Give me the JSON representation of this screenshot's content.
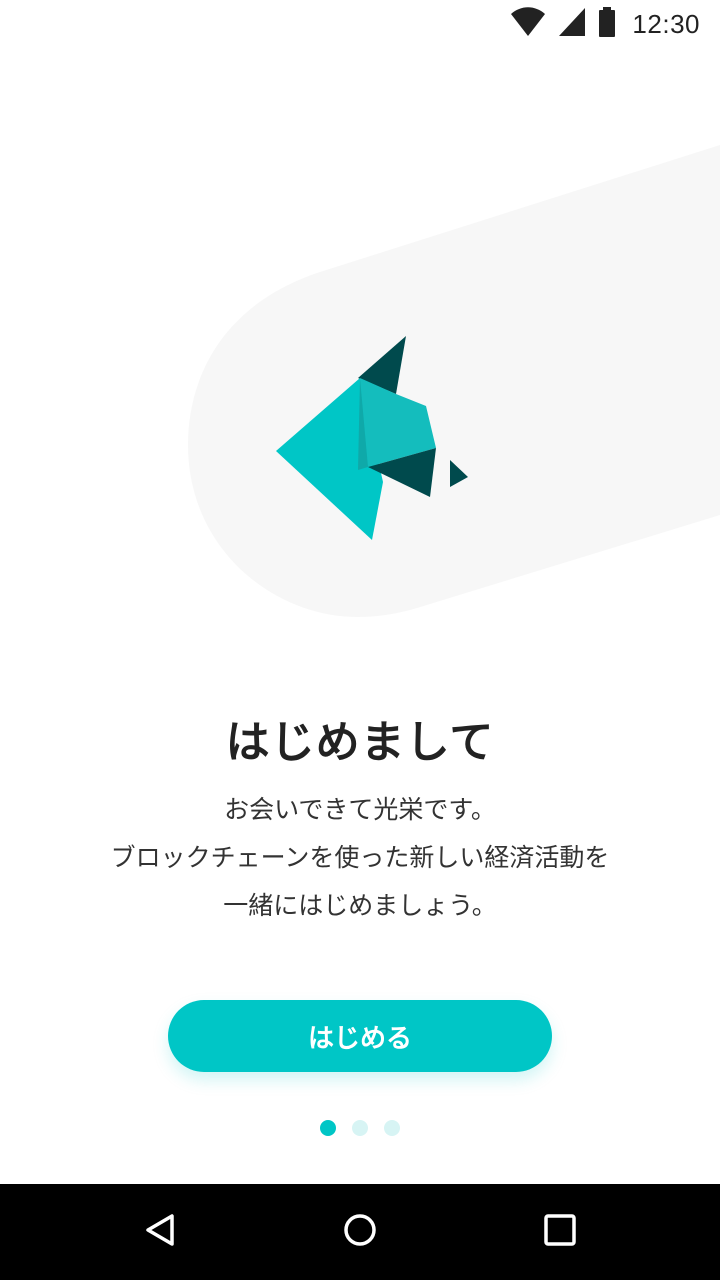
{
  "status_bar": {
    "time": "12:30",
    "icons": [
      "wifi-icon",
      "cell-signal-icon",
      "battery-icon"
    ]
  },
  "onboarding": {
    "title": "はじめまして",
    "body_lines": [
      "お会いできて光栄です。",
      "ブロックチェーンを使った新しい経済活動を",
      "一緒にはじめましょう。"
    ],
    "start_button_label": "はじめる",
    "page_indicator": {
      "total": 3,
      "current": 1
    }
  },
  "navigation_bar": {
    "buttons": [
      "back-icon",
      "home-icon",
      "recents-icon"
    ]
  },
  "colors": {
    "accent": "#00c6c6",
    "logo_dark": "#004a4d",
    "logo_mid": "#14bdbd",
    "indicator_inactive": "#d7f4f4",
    "swoosh_background": "#f7f7f7"
  }
}
